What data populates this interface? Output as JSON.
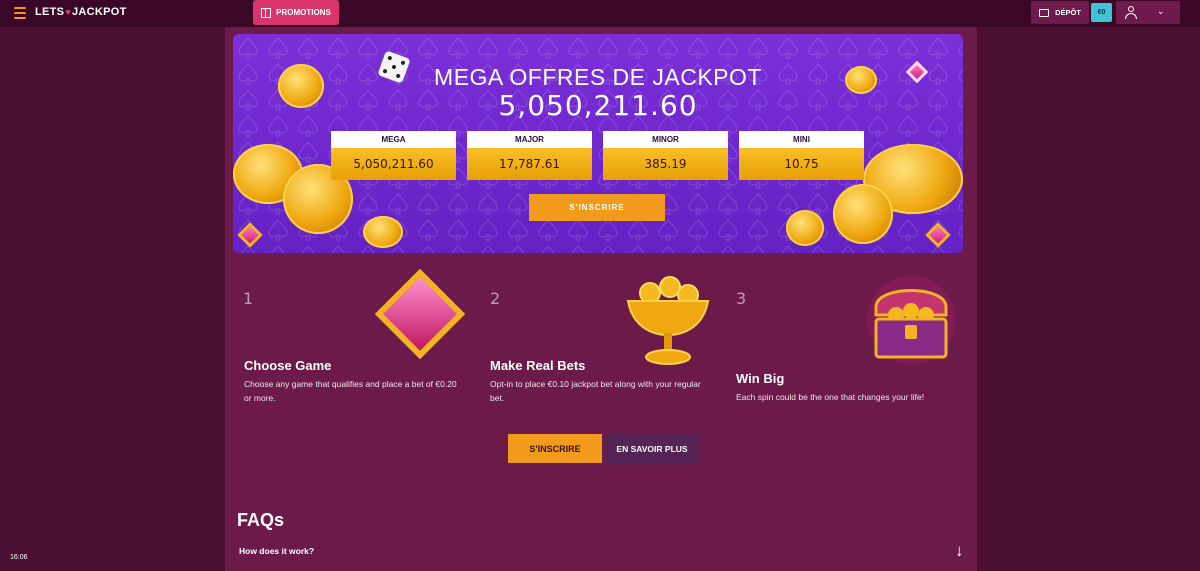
{
  "header": {
    "logo": {
      "left": "LETS",
      "right": "JACKPOT"
    },
    "promotions_label": "PROMOTIONS",
    "deposit_label": "DÉPÔT",
    "balance": "€0"
  },
  "hero": {
    "title": "MEGA OFFRES DE JACKPOT",
    "amount": "5,050,211.60",
    "jackpots": [
      {
        "name": "MEGA",
        "value": "5,050,211.60"
      },
      {
        "name": "MAJOR",
        "value": "17,787.61"
      },
      {
        "name": "MINOR",
        "value": "385.19"
      },
      {
        "name": "MINI",
        "value": "10.75"
      }
    ],
    "cta_label": "S'INSCRIRE"
  },
  "steps": [
    {
      "number": "1",
      "title": "Choose Game",
      "text": "Choose any game that qualifies and place a bet of €0.20 or more."
    },
    {
      "number": "2",
      "title": "Make Real Bets",
      "text": "Opt-in to place €0.10 jackpot bet along with your regular bet."
    },
    {
      "number": "3",
      "title": "Win Big",
      "text": "Each spin could be the one that changes your life!"
    }
  ],
  "actions": {
    "join_label": "S'INSCRIRE",
    "learn_more_label": "EN SAVOIR PLUS"
  },
  "faq": {
    "title": "FAQs",
    "first_question": "How does it work?"
  },
  "clock": "16:06",
  "colors": {
    "accent": "#f29a1c",
    "promo": "#d9356c",
    "balance": "#3ec3d8",
    "hero": "#6f28cf"
  }
}
